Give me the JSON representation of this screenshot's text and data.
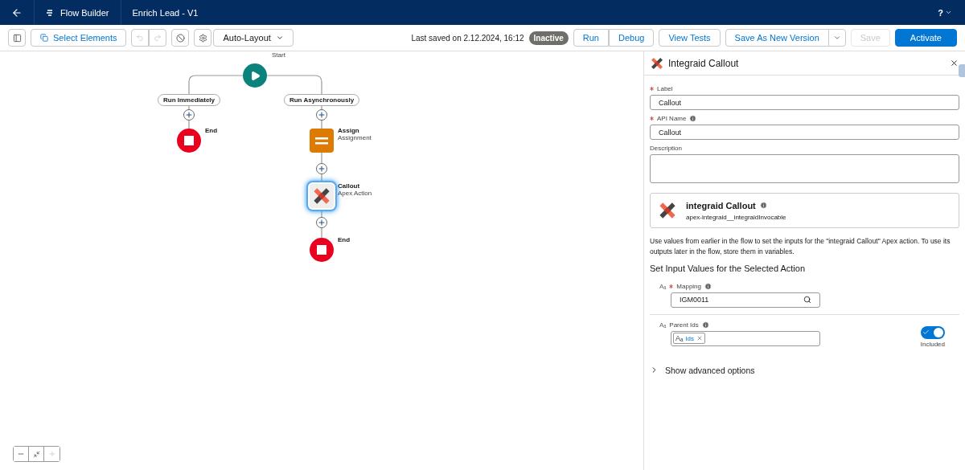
{
  "header": {
    "app": "Flow Builder",
    "title": "Enrich Lead - V1",
    "help": "?"
  },
  "toolbar": {
    "select": "Select Elements",
    "layout": "Auto-Layout",
    "saved": "Last saved on 2.12.2024, 16:12",
    "status": "Inactive",
    "buttons": [
      {
        "label": "Run",
        "kind": "group-start",
        "disabled": false
      },
      {
        "label": "Debug",
        "kind": "group-end",
        "disabled": false
      },
      {
        "label": "View Tests",
        "kind": "single",
        "disabled": false
      },
      {
        "label": "Save As New Version",
        "kind": "split",
        "disabled": false
      },
      {
        "label": "Save",
        "kind": "single",
        "disabled": true
      },
      {
        "label": "Activate",
        "kind": "brand",
        "disabled": false
      }
    ]
  },
  "canvas": {
    "start": {
      "label": "Start"
    },
    "branches": [
      {
        "label": "Run Immediately",
        "nodes": [
          {
            "kind": "end",
            "title": "End",
            "selected": false
          }
        ]
      },
      {
        "label": "Run Asynchronously",
        "nodes": [
          {
            "kind": "assignment",
            "title": "Assign",
            "subtitle": "Assignment",
            "selected": false
          },
          {
            "kind": "action",
            "title": "Callout",
            "subtitle": "Apex Action",
            "selected": true
          },
          {
            "kind": "end",
            "title": "End",
            "selected": false
          }
        ]
      }
    ]
  },
  "panel": {
    "title": "Integraid Callout",
    "fields": [
      {
        "label": "Label",
        "required": true,
        "info": false,
        "value": "Callout",
        "kind": "text"
      },
      {
        "label": "API Name",
        "required": true,
        "info": true,
        "value": "Callout",
        "kind": "text"
      },
      {
        "label": "Description",
        "required": false,
        "info": false,
        "kind": "textarea"
      }
    ],
    "action": {
      "name": "integraid Callout",
      "api": "apex-integraid__integraidInvocable"
    },
    "help": "Use values from earlier in the flow to set the inputs for the \"integraid Callout\" Apex action. To use its outputs later in the flow, store them in variables.",
    "section": "Set Input Values for the Selected Action",
    "inputs": [
      {
        "type_icon": "Aₐ",
        "label": "Mapping",
        "required": true,
        "kind": "lookup",
        "value": "IGM0011"
      },
      {
        "type_icon": "Aₐ",
        "label": "Parent Ids",
        "required": false,
        "kind": "pill",
        "pill_icon": "Aₐ",
        "pill": "Ids",
        "toggle": {
          "on": true,
          "label": "Included"
        }
      }
    ],
    "advanced": {
      "label": "Show advanced options",
      "expanded": false
    }
  }
}
